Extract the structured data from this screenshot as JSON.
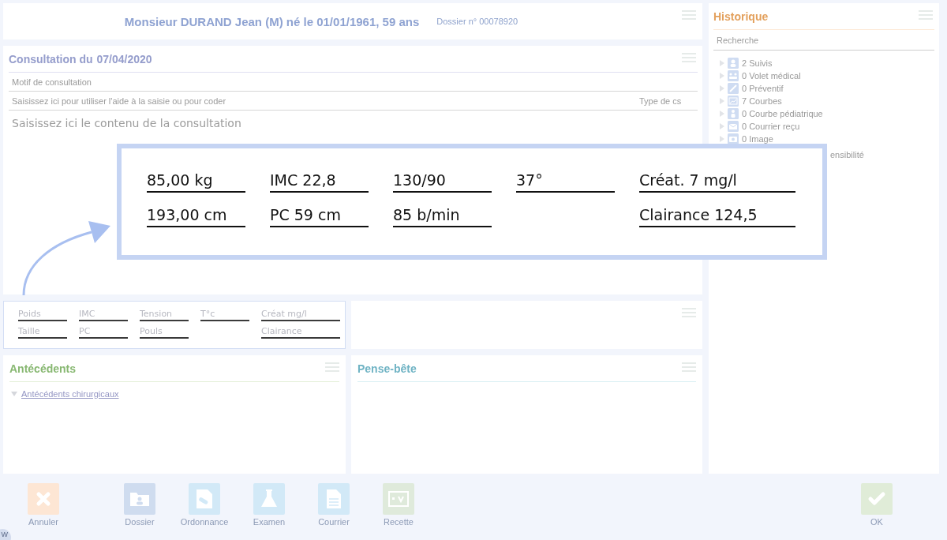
{
  "header": {
    "title": "Monsieur DURAND Jean (M) né le 01/01/1961, 59 ans",
    "dossier": "Dossier n° 00078920"
  },
  "consultation": {
    "title": "Consultation du",
    "date": "07/04/2020",
    "motif_placeholder": "Motif de consultation",
    "coding_placeholder": "Saisissez ici pour utiliser l'aide à la saisie ou pour coder",
    "type_placeholder": "Type de cs",
    "content_placeholder": "Saisissez ici le contenu de la consultation"
  },
  "vitals": {
    "columns": [
      [
        "Poids",
        "Taille"
      ],
      [
        "IMC",
        "PC"
      ],
      [
        "Tension",
        "Pouls"
      ],
      [
        "T°c"
      ],
      [
        "Créat mg/l",
        "Clairance"
      ]
    ]
  },
  "zoom_callout": {
    "columns": [
      [
        "85,00 kg",
        "193,00 cm"
      ],
      [
        "IMC 22,8",
        "PC 59 cm"
      ],
      [
        "130/90",
        "85 b/min"
      ],
      [
        "37°"
      ],
      [
        "Créat. 7 mg/l",
        "Clairance 124,5"
      ]
    ]
  },
  "antecedents": {
    "title": "Antécédents",
    "items": [
      {
        "label": "Antécédents chirurgicaux",
        "expanded": true
      }
    ]
  },
  "pense_bete": {
    "title": "Pense-bête"
  },
  "history": {
    "title": "Historique",
    "search_placeholder": "Recherche",
    "items": [
      {
        "label": "2 Suivis",
        "kind": "person"
      },
      {
        "label": "0 Volet médical",
        "kind": "group"
      },
      {
        "label": "0 Préventif",
        "kind": "syringe"
      },
      {
        "label": "7 Courbes",
        "kind": "chart"
      },
      {
        "label": "0 Courbe pédiatrique",
        "kind": "child"
      },
      {
        "label": "0 Courrier reçu",
        "kind": "mail"
      },
      {
        "label": "0 Image",
        "kind": "camera"
      }
    ],
    "covered_tail": "ensibilité"
  },
  "toolbar": [
    {
      "label": "Annuler",
      "kind": "cancel"
    },
    {
      "label": "Dossier",
      "kind": "folder"
    },
    {
      "label": "Ordonnance",
      "kind": "prescription"
    },
    {
      "label": "Examen",
      "kind": "lab"
    },
    {
      "label": "Courrier",
      "kind": "letter"
    },
    {
      "label": "Recette",
      "kind": "receipt"
    }
  ],
  "ok_button": {
    "label": "OK"
  },
  "corner_badge": "W"
}
